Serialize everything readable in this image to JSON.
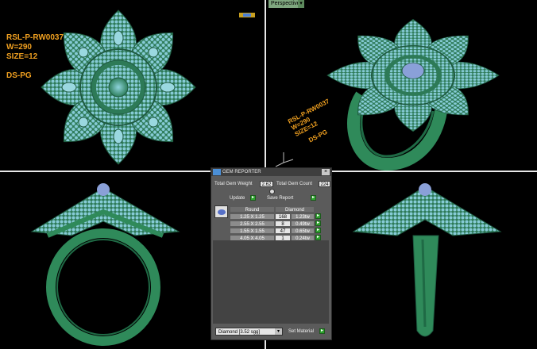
{
  "viewport_label": {
    "code": "RSL-P-RW0037",
    "weight": "W=290",
    "size": "SIZE=12",
    "maker": "DS-PG"
  },
  "perspective": {
    "label": "Perspective",
    "arrow": "▾"
  },
  "gem_reporter": {
    "title": "GEM REPORTER",
    "close": "×",
    "total_weight_label": "Total Gem Weight",
    "total_weight_value": "2.62",
    "total_count_label": "Total Gem Count",
    "total_count_value": "224",
    "update_label": "Update",
    "save_report_label": "Save Report",
    "table": {
      "col_shape": "Round",
      "col_material": "Diamond",
      "rows": [
        {
          "size": "1.25 X 1.25",
          "count": "168",
          "weight": "1.23tw"
        },
        {
          "size": "2.55 X 2.55",
          "count": "8",
          "weight": "0.49tw"
        },
        {
          "size": "1.55 X 1.55",
          "count": "47",
          "weight": "0.65tw"
        },
        {
          "size": "4.05 X 4.05",
          "count": "1",
          "weight": "0.24tw"
        }
      ]
    },
    "material_select": "Diamond   [3.52 sgg]",
    "set_material_label": "Set Material"
  },
  "colors": {
    "metal": "#2f8a5a",
    "gem": "#7ec8d8",
    "label": "#f0a020",
    "panel": "#5b5b5b"
  }
}
